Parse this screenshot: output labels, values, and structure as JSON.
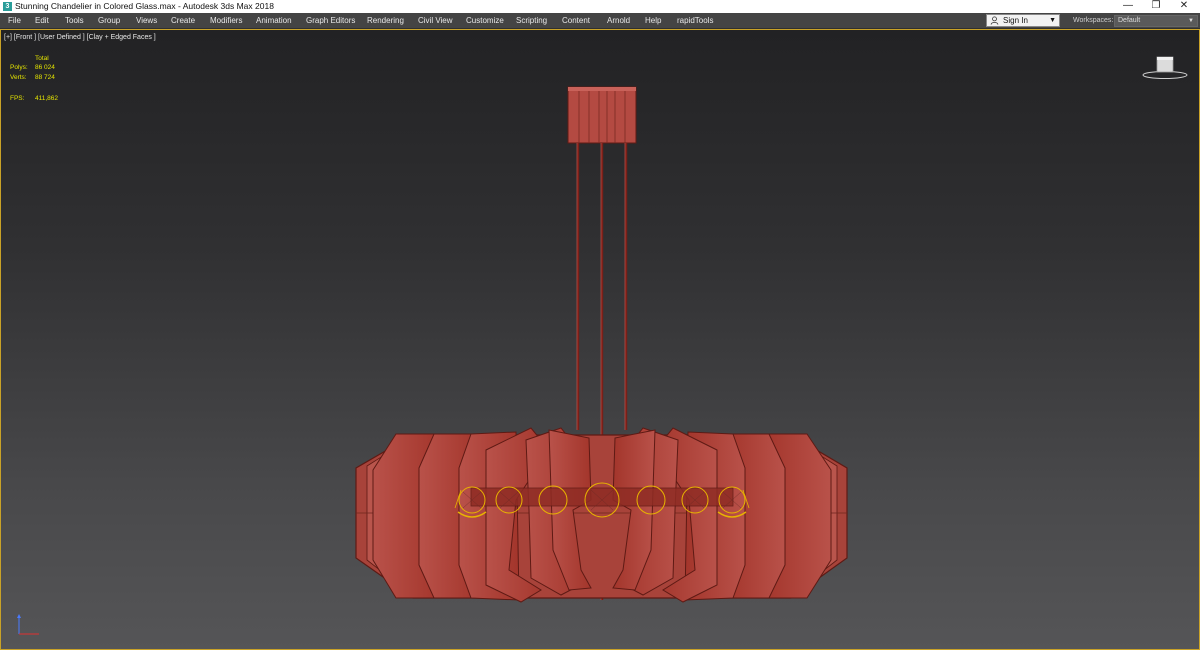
{
  "window": {
    "title": "Stunning Chandelier in Colored Glass.max - Autodesk 3ds Max 2018",
    "app_icon": "3ds-max-icon",
    "controls": {
      "minimize": "—",
      "restore": "❐",
      "close": "✕"
    }
  },
  "menu": {
    "items": [
      "File",
      "Edit",
      "Tools",
      "Group",
      "Views",
      "Create",
      "Modifiers",
      "Animation",
      "Graph Editors",
      "Rendering",
      "Civil View",
      "Customize",
      "Scripting",
      "Content",
      "Arnold",
      "Help",
      "rapidTools"
    ]
  },
  "account": {
    "signin_label": "Sign In",
    "workspaces_label": "Workspaces:",
    "workspace_value": "Default"
  },
  "viewport": {
    "label": "[+] [Front ] [User Defined ] [Clay + Edged Faces ]",
    "stats": {
      "total_label": "Total",
      "polys_label": "Polys:",
      "polys_value": "86 024",
      "verts_label": "Verts:",
      "verts_value": "88 724",
      "fps_label": "FPS:",
      "fps_value": "411,862"
    },
    "icons": {
      "viewcube": "viewcube-icon",
      "axis": "axis-tripod-icon"
    }
  },
  "colors": {
    "accent_border": "#c9a227",
    "model_fill": "#a33a2f",
    "model_edge": "#5e1a14",
    "highlight": "#e8b400",
    "stats_text": "#e5e500"
  }
}
